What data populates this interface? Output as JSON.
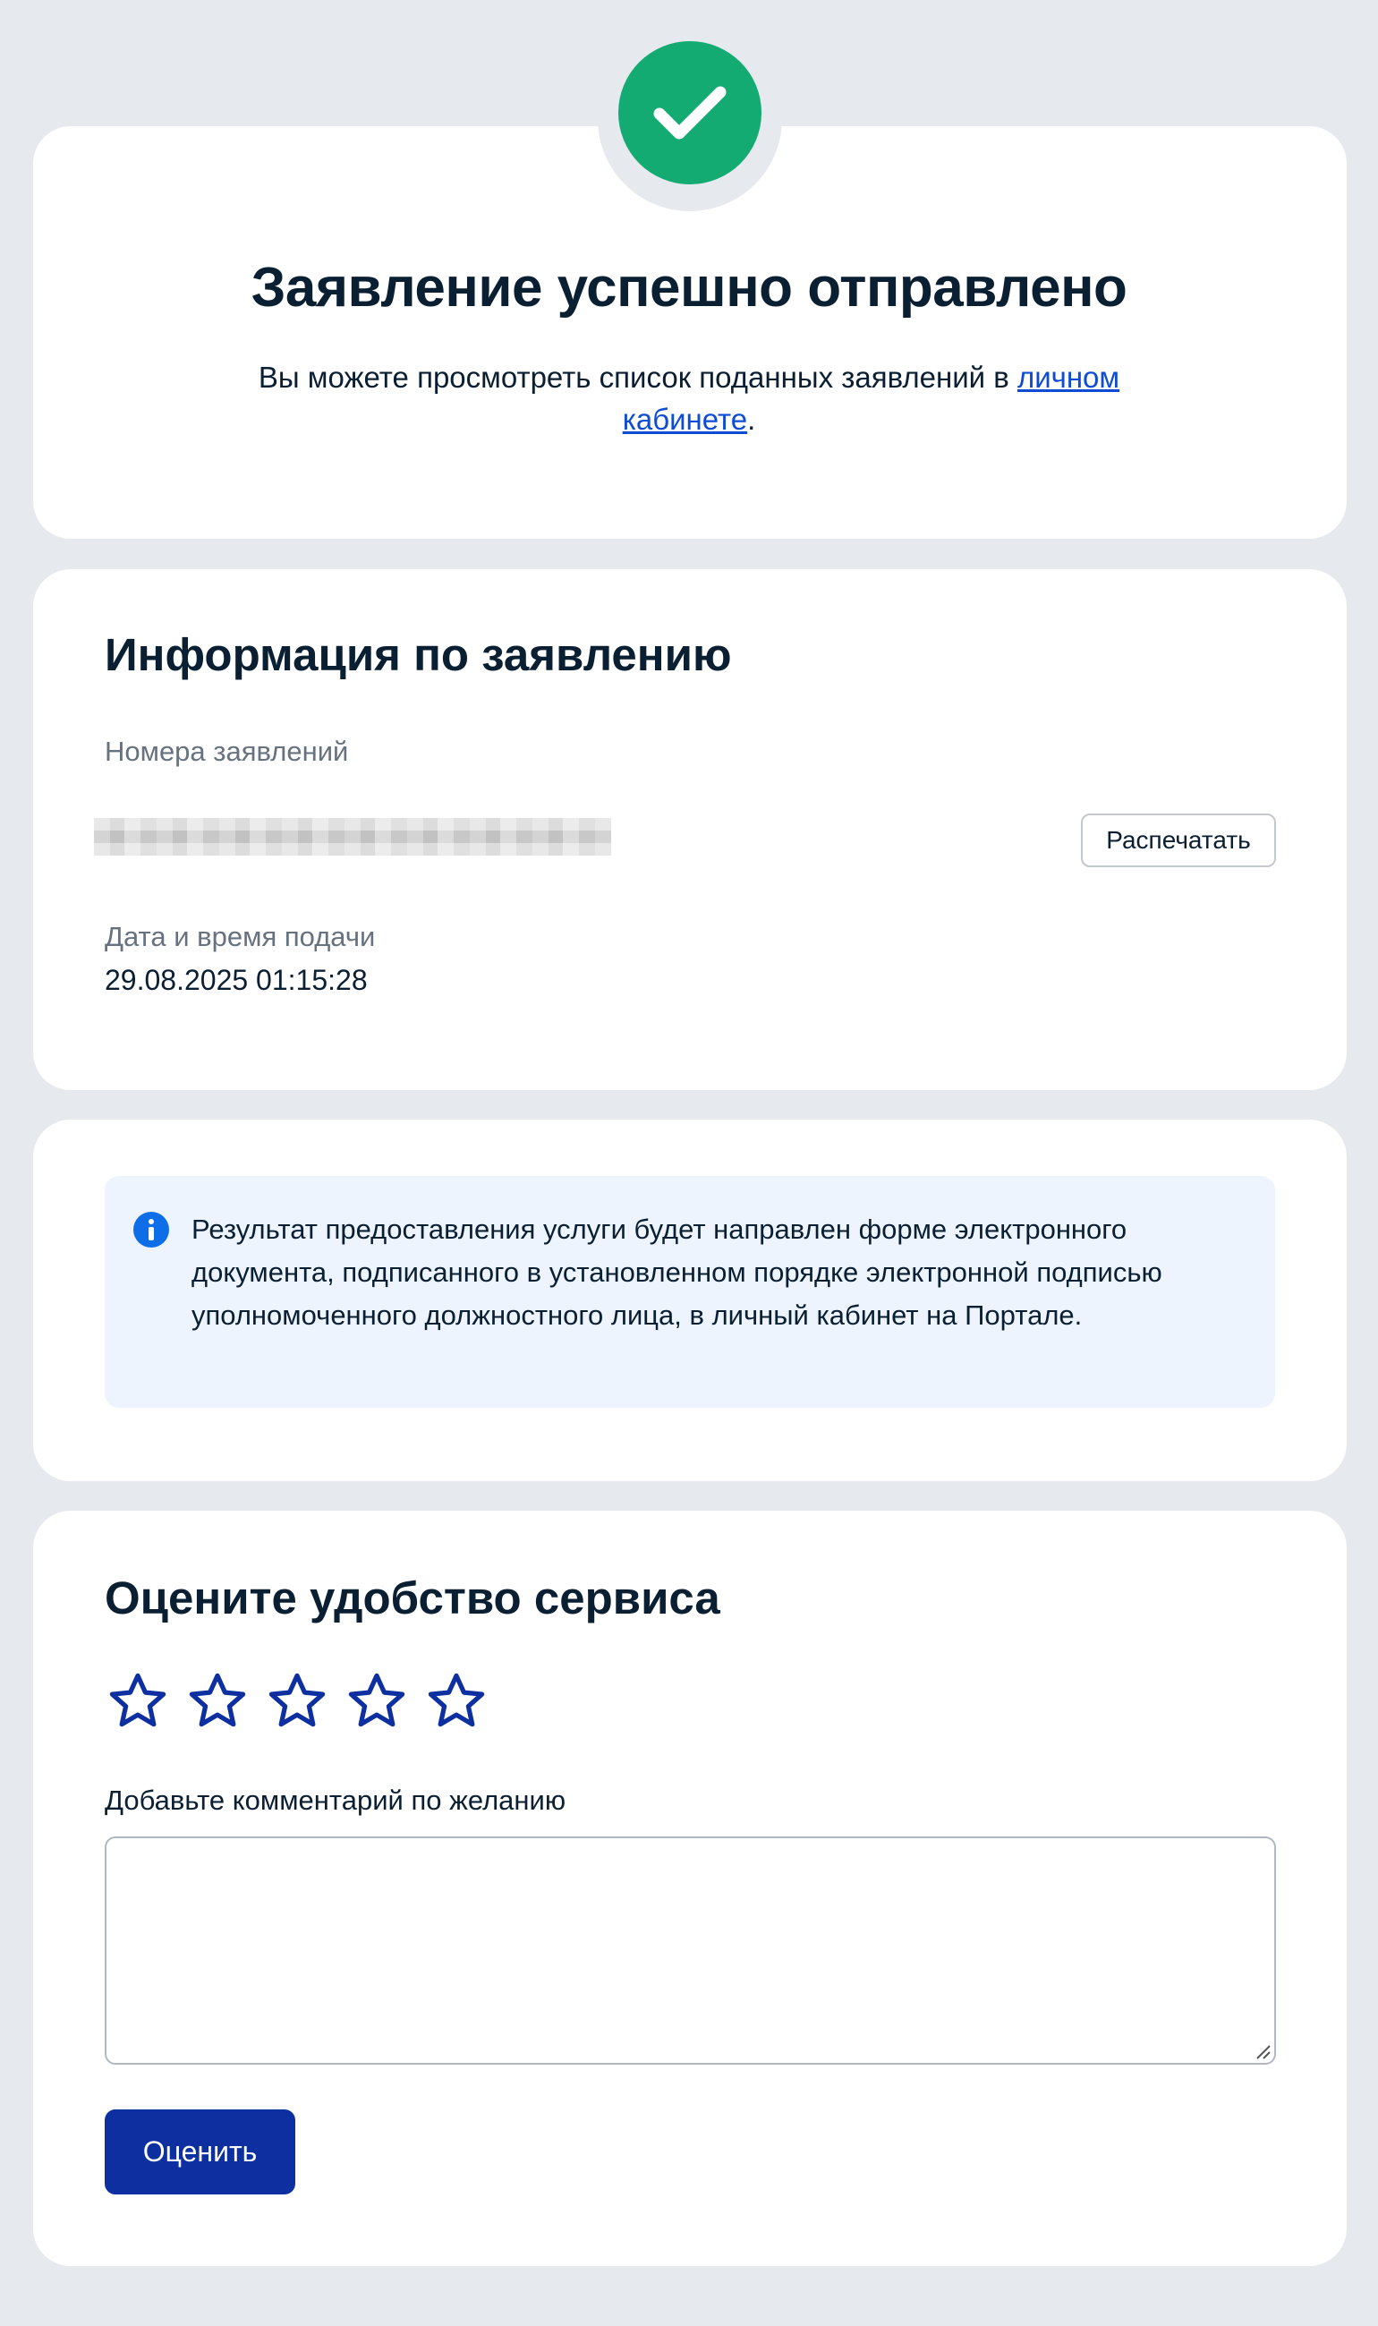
{
  "success": {
    "title": "Заявление успешно отправлено",
    "text_before_link": "Вы можете просмотреть список поданных заявлений в ",
    "link_text": "личном кабинете",
    "text_after_link": ".",
    "icon": "checkmark-icon",
    "icon_color": "#14ab72"
  },
  "info": {
    "title": "Информация по заявлению",
    "numbers_label": "Номера заявлений",
    "print_button": "Распечатать",
    "date_label": "Дата и время подачи",
    "date_value": "29.08.2025 01:15:28"
  },
  "notice": {
    "icon": "info-icon",
    "text": "Результат предоставления услуги будет направлен форме электронного документа, подписанного в установленном порядке электронной подписью уполномоченного должностного лица, в личный кабинет на Портале."
  },
  "rating": {
    "title": "Оцените удобство сервиса",
    "stars_total": 5,
    "stars_selected": 0,
    "comment_label": "Добавьте комментарий по желанию",
    "comment_value": "",
    "submit_button": "Оценить",
    "star_color": "#0d2fa0"
  }
}
